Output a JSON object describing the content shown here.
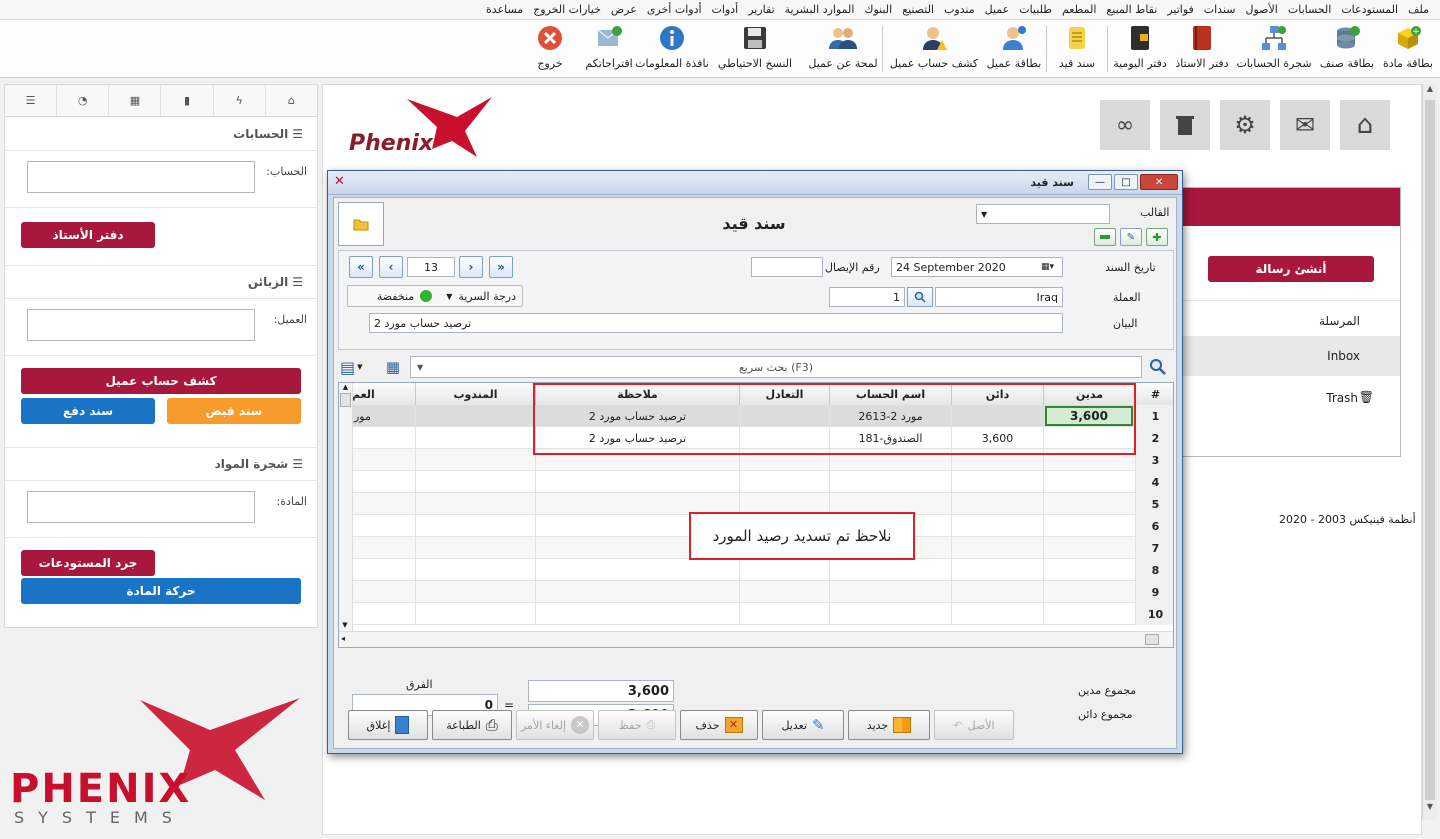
{
  "menu": [
    "ملف",
    "المستودعات",
    "الحسابات",
    "الأصول",
    "سندات",
    "فواتير",
    "نقاط المبيع",
    "المطعم",
    "طلبيات",
    "عميل",
    "مندوب",
    "التصنيع",
    "البنوك",
    "الموارد البشرية",
    "تقارير",
    "أدوات",
    "أدوات أخرى",
    "عرض",
    "خيارات الخروج",
    "مساعدة"
  ],
  "toolbar": {
    "item_card": "بطاقة مادة",
    "category_card": "بطاقة صنف",
    "accounts_tree": "شجرة الحسابات",
    "ledger": "دفتر الاستاذ",
    "journal": "دفتر اليومية",
    "voucher": "سند قيد",
    "customer_card": "بطاقة عميل",
    "customer_statement": "كشف حساب عميل",
    "customer_overview": "لمحة عن عميل",
    "backup": "النسخ الاحتياطي",
    "info_window": "نافذة المعلومات",
    "suggestions": "اقتراحاتكم",
    "exit": "خروج"
  },
  "sidebar": {
    "accounts_title": "الحسابات",
    "account_label": "الحساب:",
    "ledger_btn": "دفتر الأستاذ",
    "customers_title": "الزبائن",
    "customer_label": "العميل:",
    "statement_btn": "كشف حساب عميل",
    "receipt_btn": "سند قبض",
    "payment_btn": "سند دفع",
    "items_title": "شجرة المواد",
    "item_label": "المادة:",
    "inventory_btn": "جرد المستودعات",
    "movement_btn": "حركة المادة"
  },
  "brand": {
    "logo_small": "Phenix",
    "logo_big": "PHENIX",
    "logo_sub": "SYSTEMS"
  },
  "content": {
    "create_message": "أنشئ رسالة",
    "sent": "المرسلة",
    "inbox": "Inbox",
    "trash": "Trash",
    "copyright": "أنظمة فينيكس 2003 - 2020"
  },
  "dialog": {
    "title": "سند قيد",
    "heading": "سند قيد",
    "template_label": "القالب",
    "template_value": "",
    "date_label": "تاريخ السند",
    "date_value": "24 September   2020",
    "receipt_label": "رقم الإيصال",
    "receipt_value": "",
    "record_no": "13",
    "currency_label": "العملة",
    "currency_value": "Iraq",
    "rate_value": "1",
    "secrecy_label": "درجة السرية",
    "secrecy_value": "منخفضة",
    "statement_label": "البيان",
    "statement_value": "ترصيد حساب  مورد 2",
    "search_placeholder": "بحث سريع (F3)",
    "columns": {
      "num": "#",
      "debit": "مدين",
      "credit": "دائن",
      "account": "اسم الحساب",
      "equivalent": "التعادل",
      "note": "ملاحظة",
      "rep": "المندوب",
      "extra": "العم"
    },
    "rows": [
      {
        "num": "1",
        "debit": "3,600",
        "credit": "",
        "account": "2613-مورد 2",
        "note": "ترصيد حساب مورد 2",
        "extra": "مور"
      },
      {
        "num": "2",
        "debit": "",
        "credit": "3,600",
        "account": "181-الصندوق",
        "note": "ترصيد حساب مورد 2",
        "extra": ""
      }
    ],
    "empty_rows": [
      "3",
      "4",
      "5",
      "6",
      "7",
      "8",
      "9",
      "10"
    ],
    "annotation": "نلاحظ تم تسديد رصيد المورد",
    "total_debit_label": "مجموع  مدين",
    "total_debit": "3,600",
    "total_credit_label": "مجموع  دائن",
    "total_credit": "3,600",
    "diff_label": "الفرق",
    "diff_value": "0",
    "equals": "=",
    "buttons": {
      "origin": "الأصل",
      "new": "جديد",
      "edit": "تعديل",
      "delete": "حذف",
      "save": "حفظ",
      "cancel": "إلغاء الأمر",
      "print": "الطباعة",
      "close": "إغلاق"
    }
  },
  "colors": {
    "brand_red": "#a8173c",
    "blue": "#1a74c6",
    "orange": "#f89b2d",
    "annotation_red": "#e01f26"
  }
}
